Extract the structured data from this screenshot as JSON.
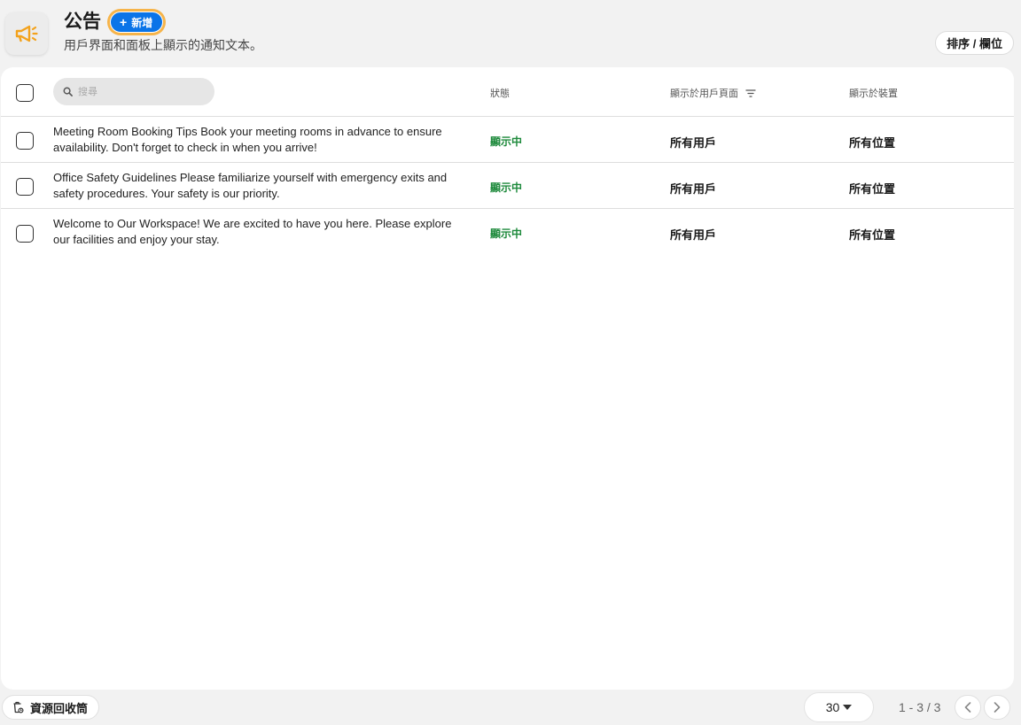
{
  "header": {
    "title": "公告",
    "add_label": "新增",
    "add_symbol": "+",
    "subtitle": "用戶界面和面板上顯示的通知文本。",
    "sort_label": "排序 / 欄位"
  },
  "icons": {
    "app": "megaphone-icon",
    "search": "search-icon",
    "filter": "filter-icon",
    "trash": "recycle-bin-icon",
    "dropdown": "caret-down-icon",
    "prev": "chevron-left-icon",
    "next": "chevron-right-icon"
  },
  "colors": {
    "accent": "#0a74e8",
    "highlight": "#f6b44a",
    "icon": "#f3a21c",
    "status_active": "#1e8a3c"
  },
  "table": {
    "search_placeholder": "搜尋",
    "columns": {
      "status": "狀態",
      "shown_on_user_page": "顯示於用戶頁面",
      "shown_on_device": "顯示於裝置"
    },
    "rows": [
      {
        "text": "Meeting Room Booking Tips Book your meeting rooms in advance to ensure availability. Don't forget to check in when you arrive!",
        "status": "顯示中",
        "user_page": "所有用戶",
        "device": "所有位置"
      },
      {
        "text": "Office Safety Guidelines Please familiarize yourself with emergency exits and safety procedures. Your safety is our priority.",
        "status": "顯示中",
        "user_page": "所有用戶",
        "device": "所有位置"
      },
      {
        "text": "Welcome to Our Workspace! We are excited to have you here. Please explore our facilities and enjoy your stay.",
        "status": "顯示中",
        "user_page": "所有用戶",
        "device": "所有位置"
      }
    ]
  },
  "footer": {
    "trash_label": "資源回收筒",
    "page_size": "30",
    "range": "1 - 3 / 3"
  }
}
